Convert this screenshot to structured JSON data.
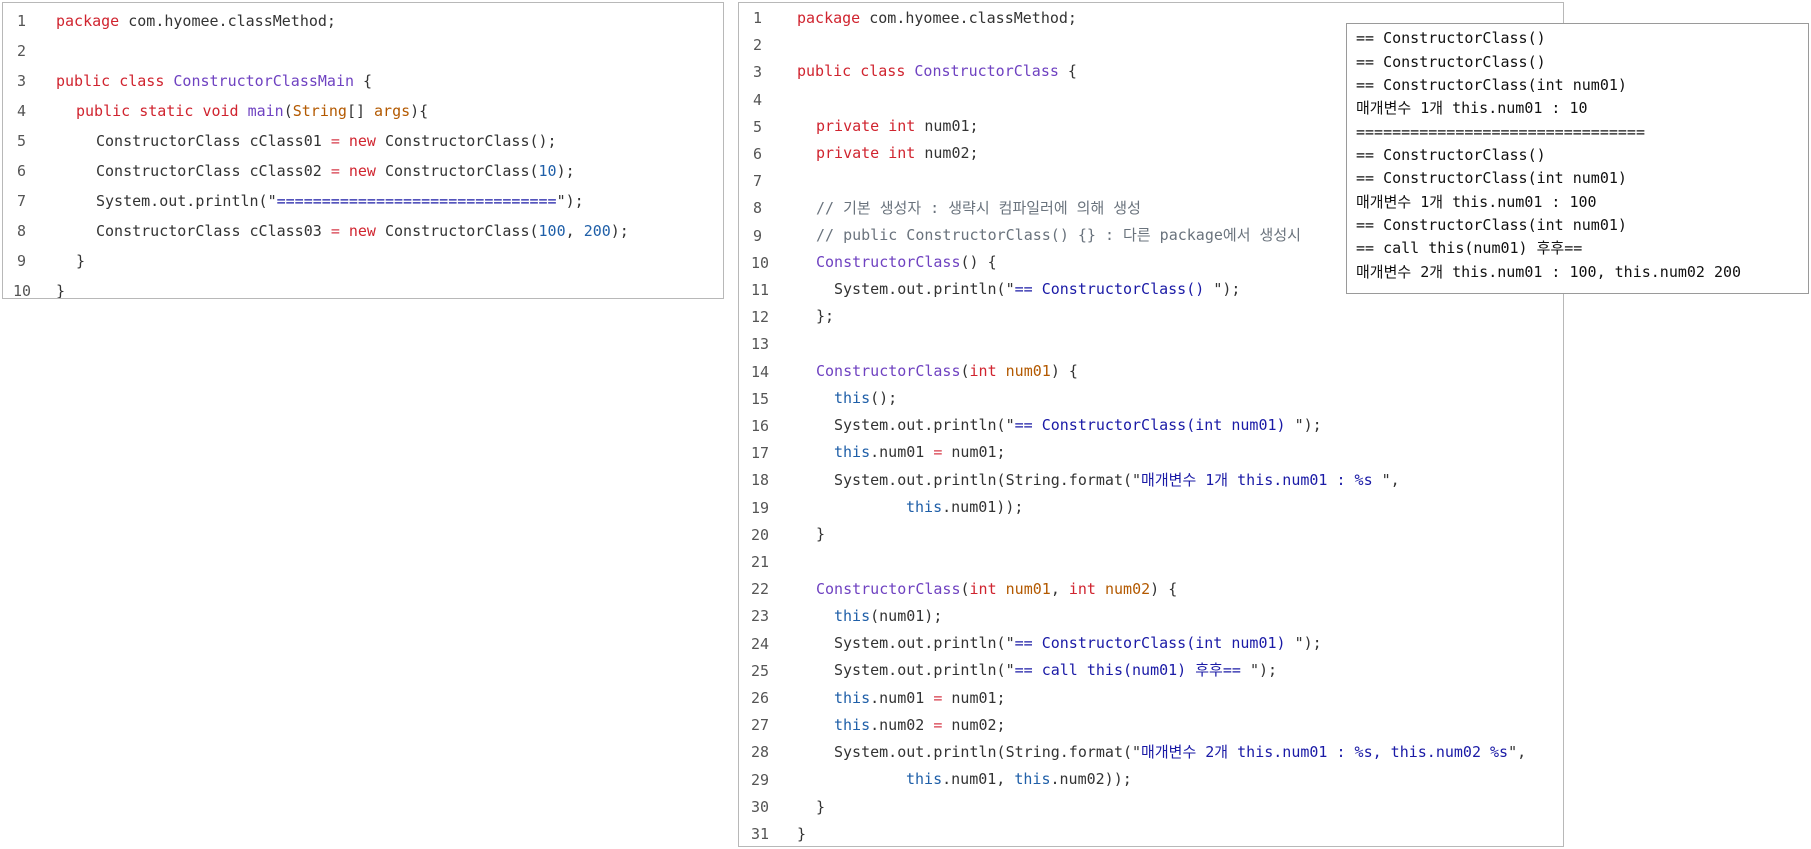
{
  "main_panel": {
    "lines": [
      {
        "n": "1",
        "code": ""
      },
      {
        "n": "2",
        "code": ""
      },
      {
        "n": "3",
        "code": ""
      },
      {
        "n": "4",
        "code": ""
      },
      {
        "n": "5",
        "code": ""
      },
      {
        "n": "6",
        "code": ""
      },
      {
        "n": "7",
        "code": ""
      },
      {
        "n": "8",
        "code": ""
      },
      {
        "n": "9",
        "code": ""
      },
      {
        "n": "10",
        "code": ""
      }
    ],
    "package_kw": "package",
    "package_name": " com.hyomee.classMethod;",
    "public_kw": "public",
    "class_kw": "class",
    "class_name": "ConstructorClassMain",
    "open_brace": " {",
    "static_kw": "static",
    "void_kw": "void",
    "main_name": "main",
    "string_type": "String",
    "args_name": "args",
    "main_tail": "){",
    "line5_a": "ConstructorClass cClass01 ",
    "line5_eq": "=",
    "line5_new": "new",
    "line5_b": " ConstructorClass();",
    "line6_a": "ConstructorClass cClass02 ",
    "line6_eq": "=",
    "line6_new": "new",
    "line6_b": " ConstructorClass(",
    "line6_num": "10",
    "line6_c": ");",
    "line7_a": "System.out.println(\"",
    "line7_str": "===============================",
    "line7_b": "\");",
    "line8_a": "ConstructorClass cClass03 ",
    "line8_eq": "=",
    "line8_new": "new",
    "line8_b": " ConstructorClass(",
    "line8_n1": "100",
    "line8_comma": ", ",
    "line8_n2": "200",
    "line8_c": ");",
    "close_inner": "}",
    "close_outer": "}"
  },
  "class_panel": {
    "line_numbers": [
      "1",
      "2",
      "3",
      "4",
      "5",
      "6",
      "7",
      "8",
      "9",
      "10",
      "11",
      "12",
      "13",
      "14",
      "15",
      "16",
      "17",
      "18",
      "19",
      "20",
      "21",
      "22",
      "23",
      "24",
      "25",
      "26",
      "27",
      "28",
      "29",
      "30",
      "31"
    ],
    "package_kw": "package",
    "package_name": " com.hyomee.classMethod;",
    "public_kw": "public",
    "class_kw": "class",
    "class_name": "ConstructorClass",
    "open_brace": " {",
    "private_kw": "private",
    "int_kw": "int",
    "num01_decl": " num01;",
    "num02_decl": " num02;",
    "comment1": "// 기본 생성자 : 생략시 컴파일러에 의해 생성",
    "comment2": "// public ConstructorClass() {} : 다른 package에서 생성시",
    "ctor_name": "ConstructorClass",
    "ctor0_tail": "() {",
    "println_prefix": "System.out.println(\"",
    "ctor0_str": "== ConstructorClass() ",
    "println_suffix": "\");",
    "ctor0_close": "};",
    "ctor1_open": "(",
    "param_num01": "num01",
    "ctor1_tail": ") {",
    "this_kw": "this",
    "this_call": "();",
    "ctor1_str": "== ConstructorClass(int num01) ",
    "this_num01_assign": ".num01 ",
    "eq": "=",
    "num01_rhs": " num01;",
    "format_prefix": "System.out.println(String.format(\"",
    "format1_str": "매개변수 1개 this.num01 : %s ",
    "format1_suffix": "\",",
    "this_num01_end": ".num01));",
    "close_brace": "}",
    "comma_sp": ", ",
    "param_num02": "num02",
    "this_num01_call": "(num01);",
    "call_str": "== call this(num01) 후후== ",
    "this_num02_assign": ".num02 ",
    "num02_rhs": " num02;",
    "format2_str": "매개변수 2개 this.num01 : %s, this.num02 %s",
    "format2_suffix": "\",",
    "this_num01_comma": ".num01, ",
    "this_num02_end": ".num02));"
  },
  "output_panel": {
    "lines": [
      "== ConstructorClass()",
      "== ConstructorClass()",
      "== ConstructorClass(int num01)",
      "매개변수 1개 this.num01 : 10",
      "================================",
      "== ConstructorClass()",
      "== ConstructorClass(int num01)",
      "매개변수 1개 this.num01 : 100",
      "== ConstructorClass(int num01)",
      "== call this(num01) 후후==",
      "매개변수 2개 this.num01 : 100, this.num02 200"
    ]
  }
}
